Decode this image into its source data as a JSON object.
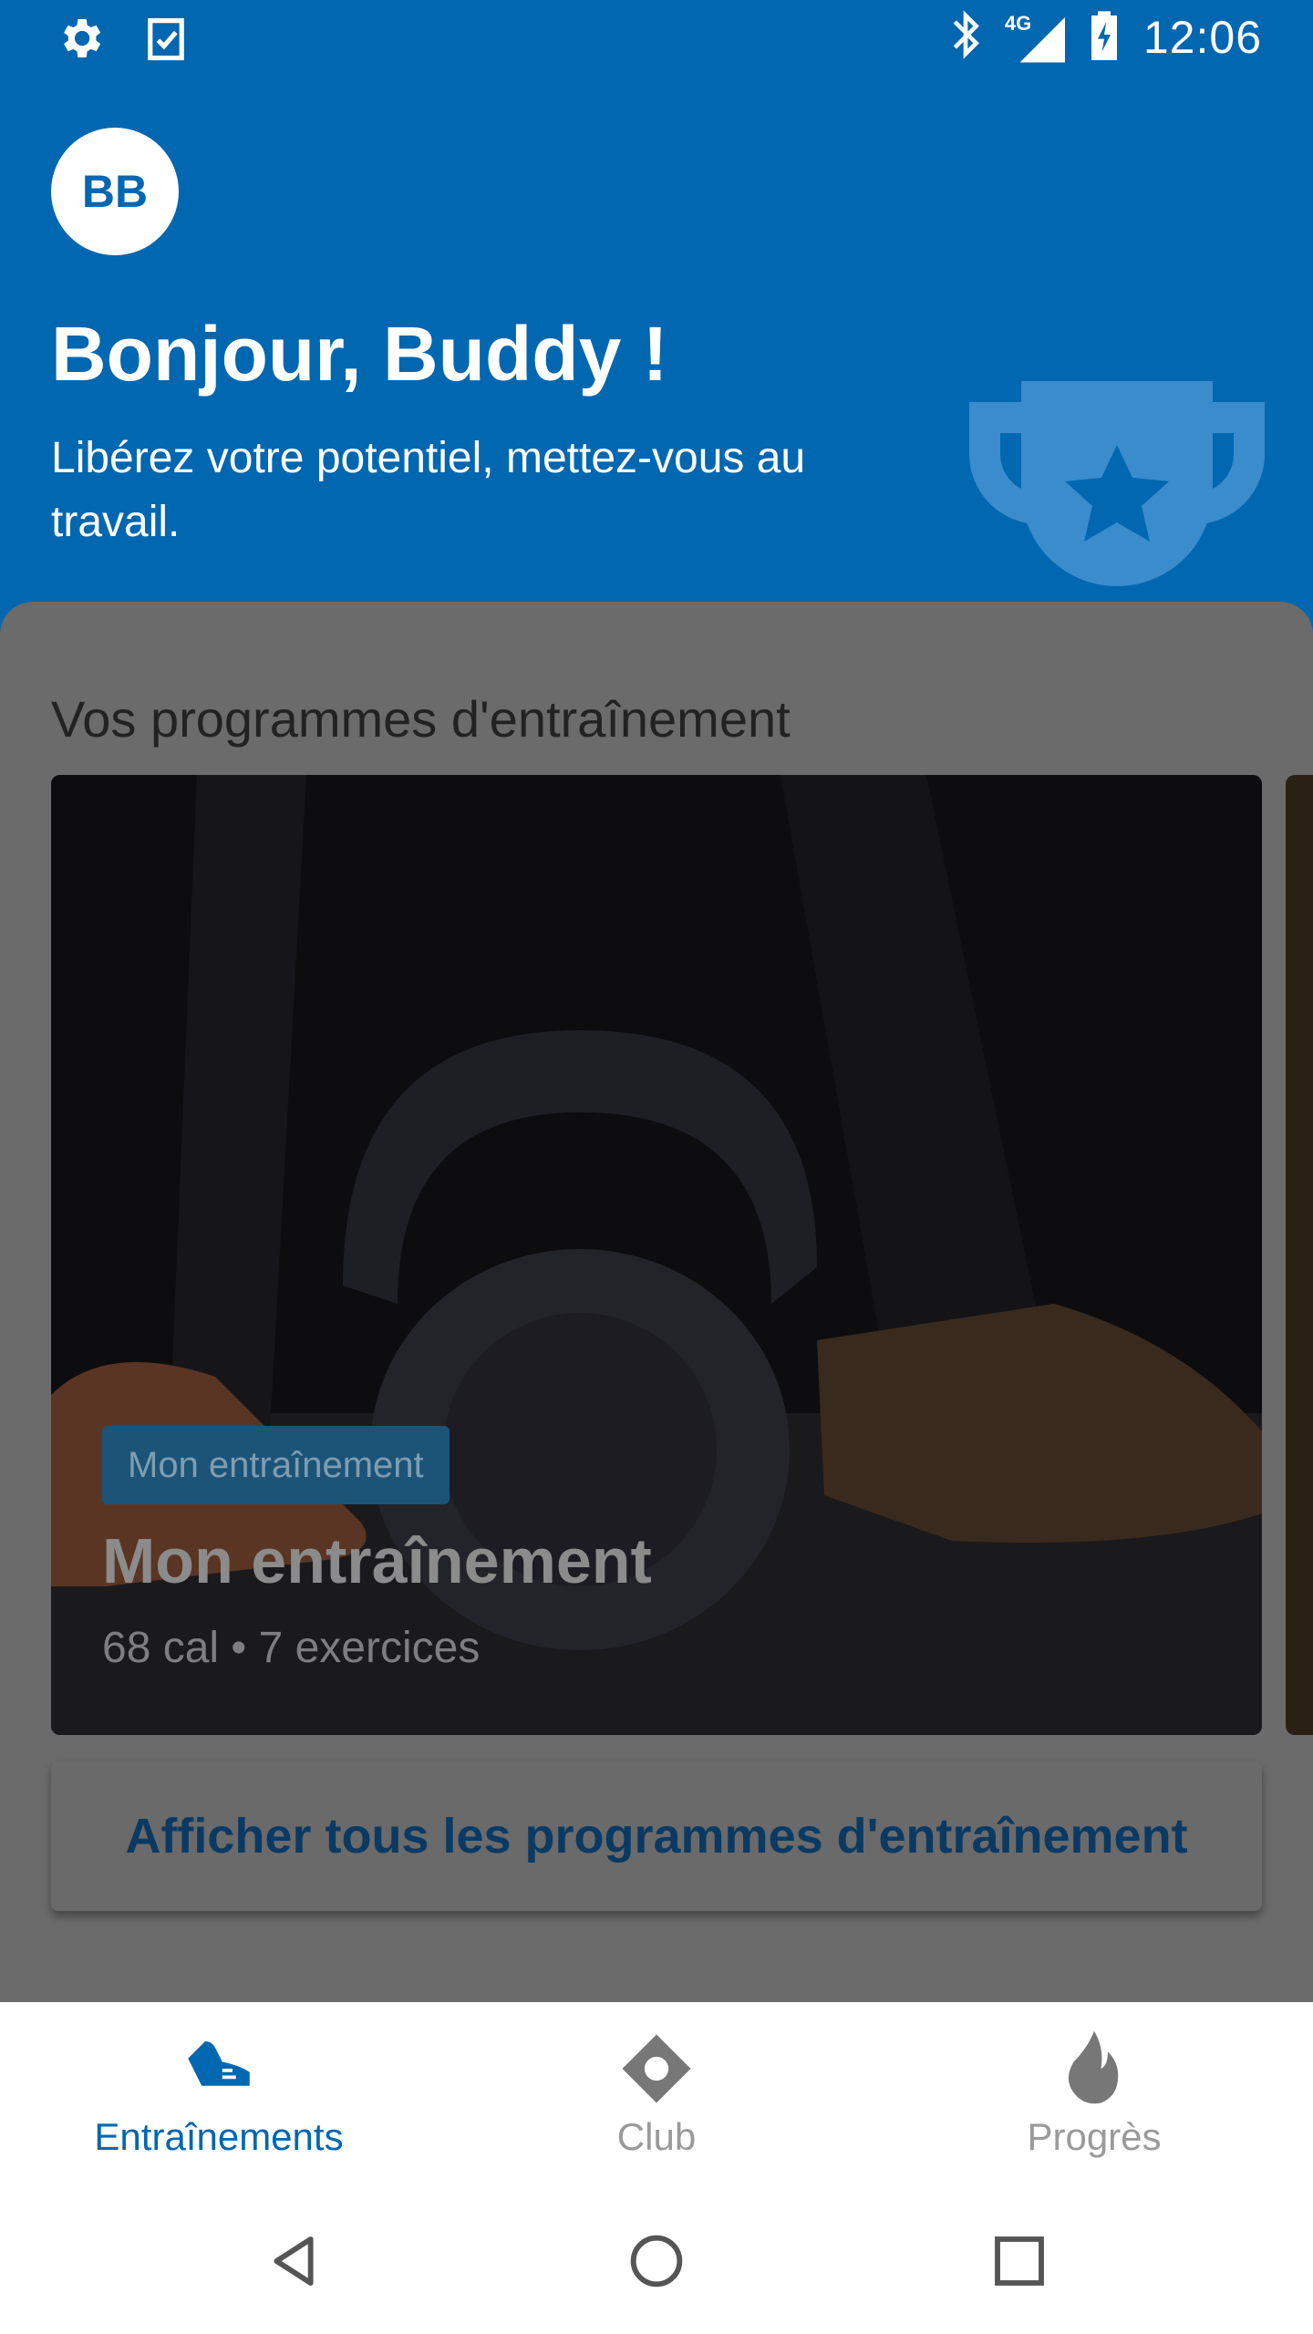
{
  "status_bar": {
    "time": "12:06",
    "network": "4G",
    "left_icons": [
      "settings-icon",
      "clipboard-check-icon"
    ],
    "right_icons": [
      "bluetooth-icon",
      "signal-icon",
      "battery-charging-icon"
    ]
  },
  "header": {
    "avatar_initials": "BB",
    "greeting": "Bonjour, Buddy !",
    "subtitle": "Libérez votre potentiel, mettez-vous au travail.",
    "decoration_icon": "trophy-icon",
    "background_color": "#0067B0"
  },
  "programs": {
    "section_title": "Vos programmes d'entraînement",
    "cards": [
      {
        "badge": "Mon entraînement",
        "title": "Mon entraînement",
        "meta": "68 cal • 7 exercices",
        "image": "kettlebell-photo"
      }
    ],
    "view_all_label": "Afficher tous les programmes d'entraînement"
  },
  "bottom_nav": {
    "items": [
      {
        "label": "Entraînements",
        "icon": "shoe-icon",
        "active": true
      },
      {
        "label": "Club",
        "icon": "location-diamond-icon",
        "active": false
      },
      {
        "label": "Progrès",
        "icon": "flame-icon",
        "active": false
      }
    ],
    "active_color": "#0067B0",
    "inactive_color": "#9a9a9a"
  },
  "system_nav": {
    "buttons": [
      "back-icon",
      "home-icon",
      "recents-icon"
    ]
  }
}
